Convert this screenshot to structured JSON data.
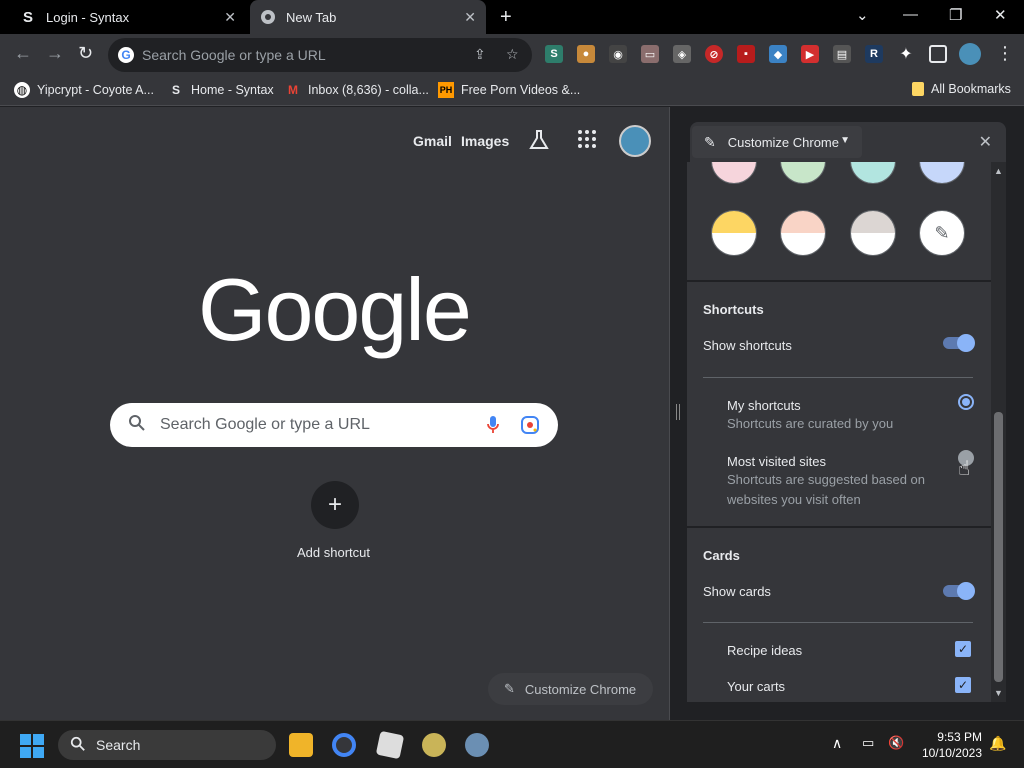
{
  "tabs": [
    {
      "title": "Login - Syntax"
    },
    {
      "title": "New Tab"
    }
  ],
  "omnibox": {
    "placeholder": "Search Google or type a URL"
  },
  "bookmarks": [
    {
      "label": "Yipcrypt - Coyote A..."
    },
    {
      "label": "Home - Syntax"
    },
    {
      "label": "Inbox (8,636) - colla..."
    },
    {
      "label": "Free Porn Videos &..."
    },
    {
      "label": "All Bookmarks"
    }
  ],
  "ntp": {
    "gmail": "Gmail",
    "images": "Images",
    "logo": "Google",
    "search_placeholder": "Search Google or type a URL",
    "add_shortcut": "Add shortcut",
    "customize": "Customize Chrome"
  },
  "panel": {
    "title": "Customize Chrome",
    "shortcuts_section": "Shortcuts",
    "show_shortcuts": "Show shortcuts",
    "my_shortcuts": "My shortcuts",
    "my_shortcuts_desc": "Shortcuts are curated by you",
    "most_visited": "Most visited sites",
    "most_visited_desc_1": "Shortcuts are suggested based on",
    "most_visited_desc_2": "websites you visit often",
    "cards_section": "Cards",
    "show_cards": "Show cards",
    "recipe_ideas": "Recipe ideas",
    "your_carts": "Your carts"
  },
  "colors": {
    "accent": "#8ab4f8",
    "panel_bg": "#35363a",
    "frame": "#000000"
  },
  "taskbar": {
    "search": "Search",
    "time": "9:53 PM",
    "date": "10/10/2023"
  }
}
